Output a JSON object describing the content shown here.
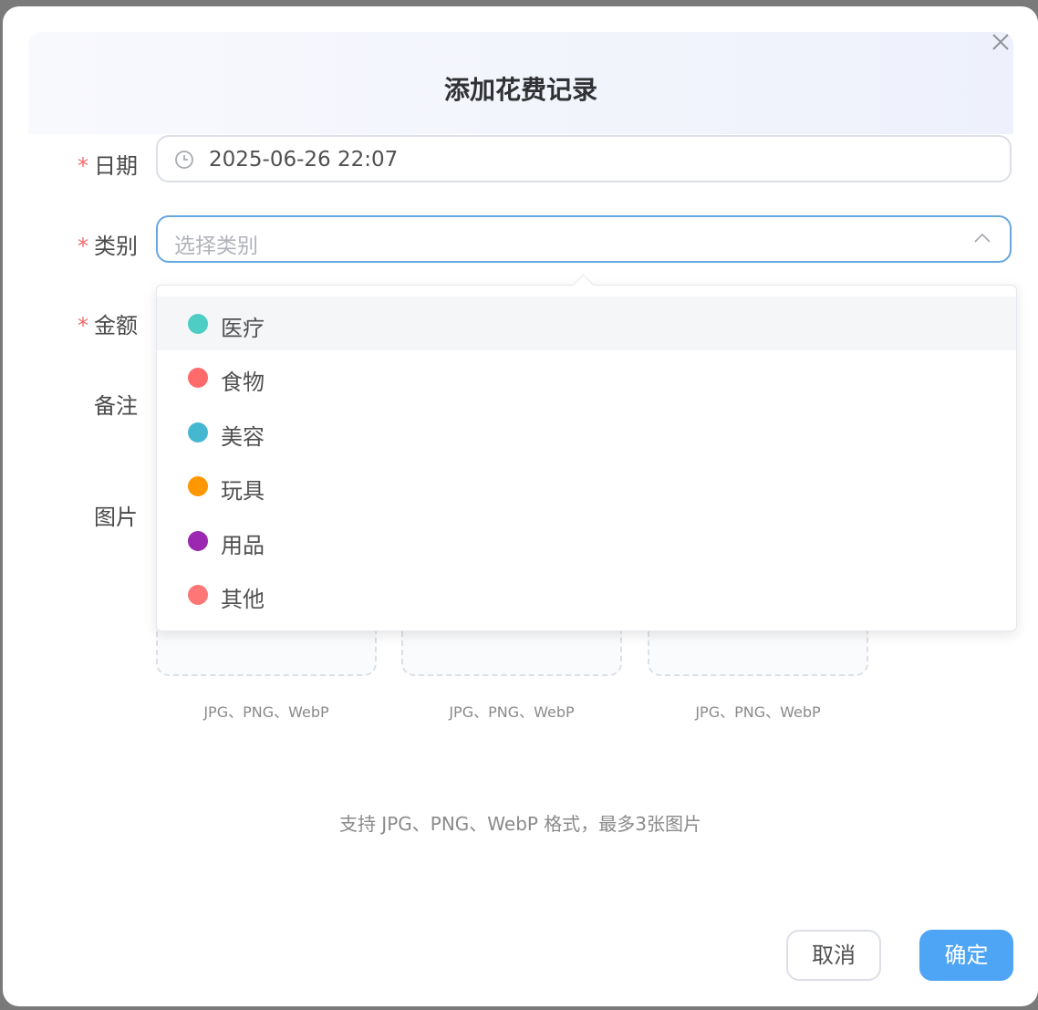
{
  "dialog": {
    "title": "添加花费记录",
    "close_icon": "close-icon"
  },
  "form": {
    "date": {
      "required_mark": "*",
      "label": "日期",
      "value": "2025-06-26 22:07",
      "icon": "clock-icon"
    },
    "category": {
      "required_mark": "*",
      "label": "类别",
      "placeholder": "选择类别",
      "icon": "chevron-up-icon"
    },
    "amount": {
      "required_mark": "*",
      "label": "金额"
    },
    "note": {
      "label": "备注"
    },
    "images": {
      "label": "图片",
      "slots": [
        {
          "formats": "JPG、PNG、WebP"
        },
        {
          "formats": "JPG、PNG、WebP"
        },
        {
          "formats": "JPG、PNG、WebP"
        }
      ],
      "hint": "支持 JPG、PNG、WebP 格式，最多3张图片"
    }
  },
  "dropdown": {
    "options": [
      {
        "label": "医疗",
        "color": "#4ecdc4"
      },
      {
        "label": "食物",
        "color": "#ff6b6b"
      },
      {
        "label": "美容",
        "color": "#45b7d1"
      },
      {
        "label": "玩具",
        "color": "#ff9800"
      },
      {
        "label": "用品",
        "color": "#9c27b0"
      },
      {
        "label": "其他",
        "color": "#ff7676"
      }
    ],
    "highlighted_index": 0
  },
  "footer": {
    "cancel_label": "取消",
    "confirm_label": "确定"
  },
  "colors": {
    "primary": "#4ea5f5",
    "required": "#f56c6c"
  }
}
